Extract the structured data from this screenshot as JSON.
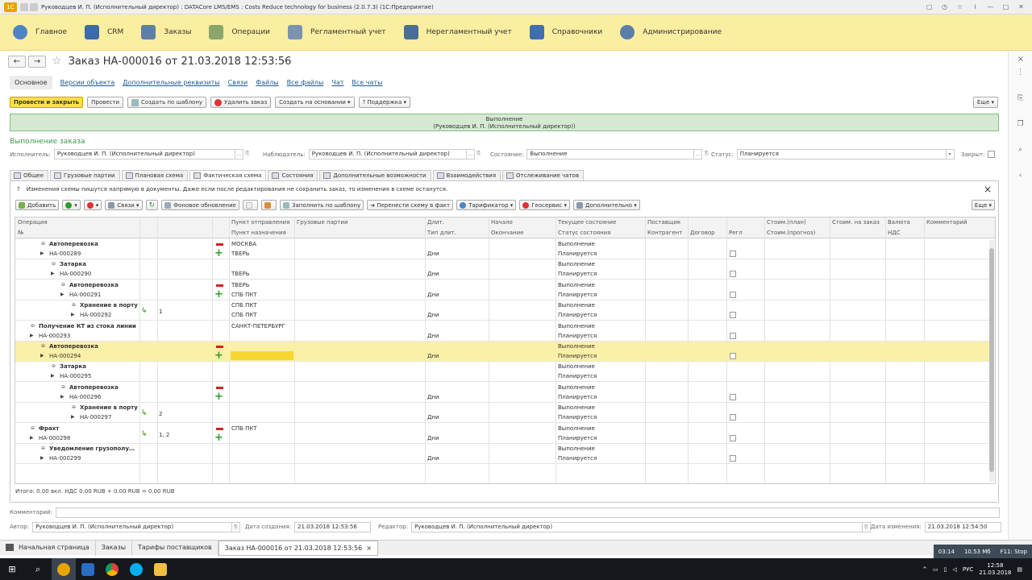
{
  "window": {
    "title": "Руководцев И. П. (Исполнительный директор) : DATACore LMS/EMS : Costs Reduce technology for business (2.0.7.3)  (1С:Предприятие)",
    "logo": "1С"
  },
  "sections": [
    {
      "label": "Главное",
      "icon": "globe-icon"
    },
    {
      "label": "CRM",
      "icon": "crm-icon"
    },
    {
      "label": "Заказы",
      "icon": "orders-icon"
    },
    {
      "label": "Операции",
      "icon": "operations-icon"
    },
    {
      "label": "Регламентный учет",
      "icon": "calculator-icon"
    },
    {
      "label": "Нерегламентный учет",
      "icon": "monitor-icon"
    },
    {
      "label": "Справочники",
      "icon": "book-icon"
    },
    {
      "label": "Администрирование",
      "icon": "gear-icon"
    }
  ],
  "doc": {
    "title": "Заказ НА-000016 от 21.03.2018 12:53:56",
    "nav_back": "←",
    "nav_forward": "→",
    "close": "×"
  },
  "links": [
    {
      "label": "Основное",
      "active": true
    },
    {
      "label": "Версии объекта"
    },
    {
      "label": "Дополнительные реквизиты"
    },
    {
      "label": "Связи"
    },
    {
      "label": "Файлы"
    },
    {
      "label": "Все файлы"
    },
    {
      "label": "Чат"
    },
    {
      "label": "Все чаты"
    }
  ],
  "toolbar": {
    "post_close": "Провести и закрыть",
    "post": "Провести",
    "create_template": "Создать по шаблону",
    "delete_order": "Удалить заказ",
    "create_basis": "Создать на основании",
    "support": "Поддержка",
    "more": "Еще"
  },
  "status_box": {
    "line1": "Выполнение",
    "line2": "(Руководцев И. П. (Исполнительный директор))"
  },
  "section_title": "Выполнение заказа",
  "form": {
    "executor_label": "Исполнитель:",
    "executor": "Руководцев И. П. (Исполнительный директор)",
    "observer_label": "Наблюдатель:",
    "observer": "Руководцев И. П. (Исполнительный директор)",
    "state_label": "Состояние:",
    "state": "Выполнение",
    "status_label": "Статус:",
    "status": "Планируется",
    "closed_label": "Закрыт:"
  },
  "form_tabs": [
    {
      "label": "Общее"
    },
    {
      "label": "Грузовые партии"
    },
    {
      "label": "Плановая схема"
    },
    {
      "label": "Фактическая схема",
      "active": true
    },
    {
      "label": "Состояния"
    },
    {
      "label": "Дополнительные возможности"
    },
    {
      "label": "Взаимодействия"
    },
    {
      "label": "Отслеживание чатов"
    }
  ],
  "notice": {
    "q": "?",
    "text": "Изменения схемы пишутся напрямую в документы. Даже если после редактирования не сохранить заказ, то изменения в схеме останутся.",
    "close": "×"
  },
  "grid_toolbar": {
    "add": "Добавить",
    "links": "Связи",
    "background": "Фоновое обновление",
    "fill_template": "Заполнить по шаблону",
    "move_to_fact": "Перенести схему в факт",
    "tarifficator": "Тарификатор",
    "geoservice": "Геосервис",
    "additional": "Дополнительно",
    "more": "Еще"
  },
  "grid_headers": {
    "operation": "Операция",
    "num": "№",
    "from": "Пункт отправления",
    "to": "Пункт назначения",
    "cargo": "Грузовые партии",
    "dur": "Длит.",
    "dur_type": "Тип длит.",
    "start": "Начало",
    "end": "Окончание",
    "cur_state": "Текущее состояние",
    "exec_state": "Статус состояния",
    "supplier": "Поставщик",
    "counterparty": "Контрагент",
    "contract": "Договор",
    "regl": "Регл",
    "cost_plan": "Стоим.(план)",
    "cost_forecast": "Стоим.(прогноз)",
    "cost_order": "Стоим. на заказ",
    "currency": "Валюта",
    "vat": "НДС",
    "comment": "Комментарий"
  },
  "rows": [
    {
      "op": "Автоперевозка",
      "num": "НА-000289",
      "indent": 1,
      "from": "МОСКВА",
      "to": "ТВЕРЬ",
      "dur_type": "Дни",
      "cur": "Выполнение",
      "st": "Планируется",
      "minus": true,
      "plus": true,
      "regl": true
    },
    {
      "op": "Затарка",
      "num": "НА-000290",
      "indent": 2,
      "from": "",
      "to": "ТВЕРЬ",
      "dur_type": "Дни",
      "cur": "Выполнение",
      "st": "Планируется",
      "regl": true
    },
    {
      "op": "Автоперевозка",
      "num": "НА-000291",
      "indent": 3,
      "from": "ТВЕРЬ",
      "to": "СПБ ПКТ",
      "dur_type": "Дни",
      "cur": "Выполнение",
      "st": "Планируется",
      "minus": true,
      "plus": true,
      "regl": true
    },
    {
      "op": "Хранение в порту",
      "num": "НА-000292",
      "indent": 4,
      "from": "СПБ ПКТ",
      "to": "СПБ ПКТ",
      "dur_type": "Дни",
      "cur": "Выполнение",
      "st": "Планируется",
      "link": "1",
      "regl": true
    },
    {
      "op": "Получение КТ из стока линии",
      "num": "НА-000293",
      "indent": 0,
      "from": "САНКТ-ПЕТЕРБУРГ",
      "to": "",
      "dur_type": "Дни",
      "cur": "Выполнение",
      "st": "Планируется",
      "regl": true
    },
    {
      "op": "Автоперевозка",
      "num": "НА-000294",
      "indent": 1,
      "from": "",
      "to": "",
      "dur_type": "Дни",
      "cur": "Выполнение",
      "st": "Планируется",
      "minus": true,
      "plus": true,
      "sel": true,
      "regl": true
    },
    {
      "op": "Затарка",
      "num": "НА-000295",
      "indent": 2,
      "from": "",
      "to": "",
      "dur_type": "",
      "cur": "Выполнение",
      "st": "Планируется",
      "regl": false
    },
    {
      "op": "Автоперевозка",
      "num": "НА-000296",
      "indent": 3,
      "from": "",
      "to": "",
      "dur_type": "Дни",
      "cur": "Выполнение",
      "st": "Планируется",
      "minus": true,
      "plus": true,
      "regl": true
    },
    {
      "op": "Хранение в порту",
      "num": "НА-000297",
      "indent": 4,
      "from": "",
      "to": "",
      "dur_type": "Дни",
      "cur": "Выполнение",
      "st": "Планируется",
      "link": "2",
      "regl": true
    },
    {
      "op": "Фрахт",
      "num": "НА-000298",
      "indent": 0,
      "from": "СПБ ПКТ",
      "to": "",
      "dur_type": "Дни",
      "cur": "Выполнение",
      "st": "Планируется",
      "minus": true,
      "plus": true,
      "link": "1, 2",
      "regl": true
    },
    {
      "op": "Уведомление грузополу…",
      "num": "НА-000299",
      "indent": 1,
      "from": "",
      "to": "",
      "dur_type": "Дни",
      "cur": "Выполнение",
      "st": "Планируется",
      "regl": true
    }
  ],
  "total": "Итого: 0.00 вкл. НДС 0.00 RUB + 0.00 RUB = 0.00 RUB",
  "comment_label": "Комментарий:",
  "footer": {
    "author_label": "Автор:",
    "author": "Руководцев И. П. (Исполнительный директор)",
    "created_label": "Дата создания:",
    "created": "21.03.2018 12:53:56",
    "editor_label": "Редактор:",
    "editor": "Руководцев И. П. (Исполнительный директор)",
    "changed_label": "Дата изменения:",
    "changed": "21.03.2018 12:54:50"
  },
  "task_pages": [
    {
      "label": "Начальная страница"
    },
    {
      "label": "Заказы"
    },
    {
      "label": "Тарифы поставщиков"
    },
    {
      "label": "Заказ НА-000016 от 21.03.2018 12:53:56",
      "active": true
    }
  ],
  "meter": {
    "time": "03:14",
    "mem": "10.53 Мб",
    "f11": "F11: Stop"
  },
  "tray": {
    "lang": "РУС",
    "time": "12:58",
    "date": "21.03.2018"
  },
  "colors": {
    "sections_bg": "#fbeea0",
    "selection": "#fbf0a8",
    "status_green": "#d6ead3",
    "accent_green": "#3c9a4b",
    "primary_button": "#fce04b"
  }
}
